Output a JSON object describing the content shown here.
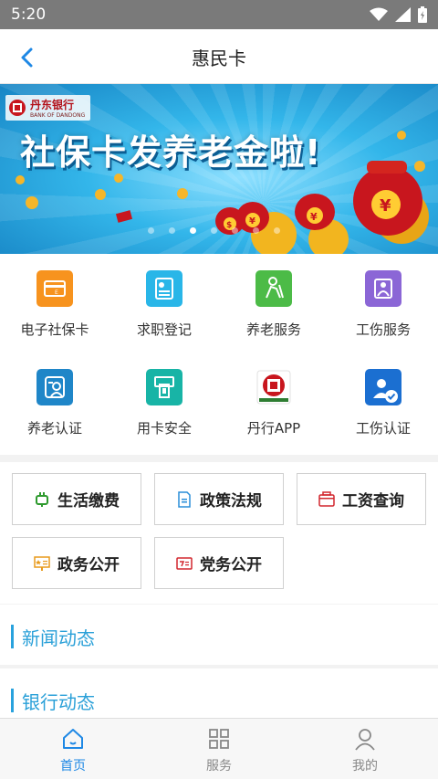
{
  "status_bar": {
    "time": "5:20",
    "icons": [
      "wifi-icon",
      "signal-icon",
      "battery-icon"
    ]
  },
  "header": {
    "title": "惠民卡",
    "back_icon": "chevron-left-icon"
  },
  "banner": {
    "bank_name": "丹东银行",
    "bank_name_en": "BANK OF DANDONG",
    "headline": "社保卡发养老金啦!",
    "slide_count": 7,
    "active_slide": 3
  },
  "quick_grid": [
    {
      "label": "电子社保卡",
      "icon": "e-card-icon",
      "color": "#f7931e"
    },
    {
      "label": "求职登记",
      "icon": "resume-icon",
      "color": "#29b6e8"
    },
    {
      "label": "养老服务",
      "icon": "elder-icon",
      "color": "#4cbb47"
    },
    {
      "label": "工伤服务",
      "icon": "injury-icon",
      "color": "#8b66d6"
    },
    {
      "label": "养老认证",
      "icon": "face-verify-icon",
      "color": "#1f86c8"
    },
    {
      "label": "用卡安全",
      "icon": "atm-icon",
      "color": "#18b4a6"
    },
    {
      "label": "丹行APP",
      "icon": "bank-app-icon",
      "color": "#c8161e"
    },
    {
      "label": "工伤认证",
      "icon": "user-check-icon",
      "color": "#1b6fd1"
    }
  ],
  "services": [
    {
      "label": "生活缴费",
      "icon": "plug-icon"
    },
    {
      "label": "政策法规",
      "icon": "document-icon"
    },
    {
      "label": "工资查询",
      "icon": "wallet-icon"
    },
    {
      "label": "政务公开",
      "icon": "board-icon"
    },
    {
      "label": "党务公开",
      "icon": "notice-icon"
    }
  ],
  "sections": {
    "news": "新闻动态",
    "bank": "银行动态"
  },
  "tabbar": [
    {
      "label": "首页",
      "icon": "home-icon",
      "active": true
    },
    {
      "label": "服务",
      "icon": "grid-icon",
      "active": false
    },
    {
      "label": "我的",
      "icon": "user-icon",
      "active": false
    }
  ]
}
